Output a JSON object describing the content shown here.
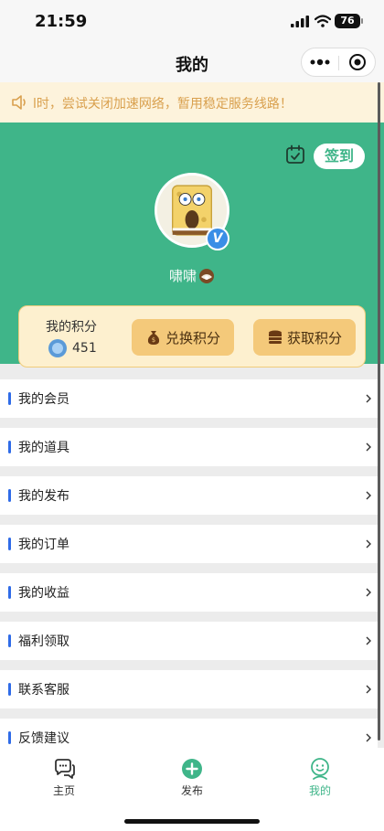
{
  "status_bar": {
    "time": "21:59",
    "battery": "76"
  },
  "nav": {
    "title": "我的"
  },
  "notice": {
    "text": "l时，尝试关闭加速网络，暂用稳定服务线路！"
  },
  "profile": {
    "checkin_label": "签到",
    "username": "啸啸"
  },
  "points": {
    "label": "我的积分",
    "value": "451",
    "exchange_label": "兑换积分",
    "earn_label": "获取积分"
  },
  "menu": [
    {
      "label": "我的会员"
    },
    {
      "label": "我的道具"
    },
    {
      "label": "我的发布"
    },
    {
      "label": "我的订单"
    },
    {
      "label": "我的收益"
    },
    {
      "label": "福利领取"
    },
    {
      "label": "联系客服"
    },
    {
      "label": "反馈建议"
    }
  ],
  "tabs": [
    {
      "label": "主页",
      "icon": "chat-bubble-icon"
    },
    {
      "label": "发布",
      "icon": "plus-circle-icon"
    },
    {
      "label": "我的",
      "icon": "user-icon"
    }
  ],
  "colors": {
    "primary_green": "#3fb589",
    "accent_blue": "#2f6be8",
    "notice_text": "#d9a04e"
  }
}
